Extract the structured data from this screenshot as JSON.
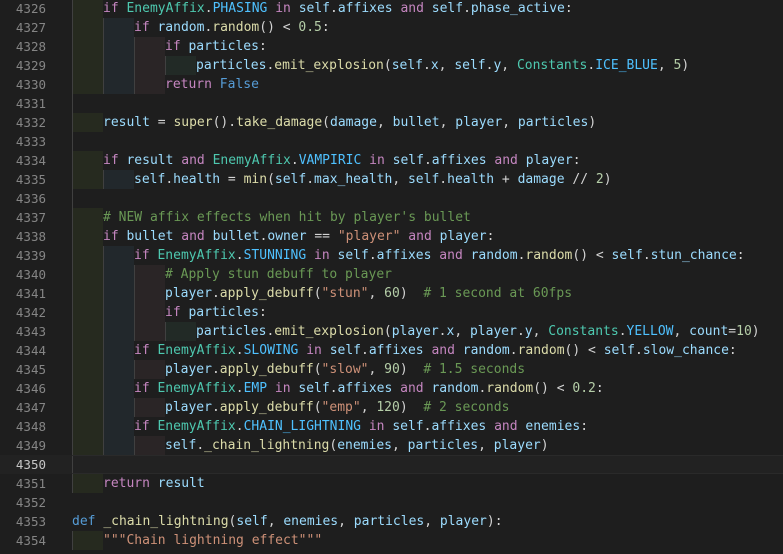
{
  "editor": {
    "current_line": 4350,
    "colors": {
      "background": "#1e1e1e",
      "keyword": "#c586c0",
      "class": "#4ec9b0",
      "constant": "#4fc1ff",
      "variable": "#9cdcfe",
      "function": "#dcdcaa",
      "string": "#ce9178",
      "number": "#b5cea8",
      "comment": "#6a9955"
    },
    "lines": [
      {
        "n": "4326",
        "indent": 1,
        "tokens": [
          [
            "kw",
            "if "
          ],
          [
            "cls",
            "EnemyAffix"
          ],
          [
            "op",
            "."
          ],
          [
            "const",
            "PHASING"
          ],
          [
            "kw",
            " in "
          ],
          [
            "var",
            "self"
          ],
          [
            "op",
            "."
          ],
          [
            "var",
            "affixes"
          ],
          [
            "kw",
            " and "
          ],
          [
            "var",
            "self"
          ],
          [
            "op",
            "."
          ],
          [
            "var",
            "phase_active"
          ],
          [
            "op",
            ":"
          ]
        ]
      },
      {
        "n": "4327",
        "indent": 2,
        "tokens": [
          [
            "kw",
            "if "
          ],
          [
            "var",
            "random"
          ],
          [
            "op",
            "."
          ],
          [
            "fn",
            "random"
          ],
          [
            "op",
            "() < "
          ],
          [
            "num",
            "0.5"
          ],
          [
            "op",
            ":"
          ]
        ]
      },
      {
        "n": "4328",
        "indent": 3,
        "tokens": [
          [
            "kw",
            "if "
          ],
          [
            "var",
            "particles"
          ],
          [
            "op",
            ":"
          ]
        ]
      },
      {
        "n": "4329",
        "indent": 4,
        "tokens": [
          [
            "var",
            "particles"
          ],
          [
            "op",
            "."
          ],
          [
            "fn",
            "emit_explosion"
          ],
          [
            "op",
            "("
          ],
          [
            "var",
            "self"
          ],
          [
            "op",
            "."
          ],
          [
            "var",
            "x"
          ],
          [
            "op",
            ", "
          ],
          [
            "var",
            "self"
          ],
          [
            "op",
            "."
          ],
          [
            "var",
            "y"
          ],
          [
            "op",
            ", "
          ],
          [
            "cls",
            "Constants"
          ],
          [
            "op",
            "."
          ],
          [
            "const",
            "ICE_BLUE"
          ],
          [
            "op",
            ", "
          ],
          [
            "num",
            "5"
          ],
          [
            "op",
            ")"
          ]
        ]
      },
      {
        "n": "4330",
        "indent": 3,
        "tokens": [
          [
            "kw",
            "return "
          ],
          [
            "bool",
            "False"
          ]
        ]
      },
      {
        "n": "4331",
        "indent": 0,
        "tokens": []
      },
      {
        "n": "4332",
        "indent": 1,
        "tokens": [
          [
            "var",
            "result"
          ],
          [
            "op",
            " = "
          ],
          [
            "fn",
            "super"
          ],
          [
            "op",
            "()."
          ],
          [
            "fn",
            "take_damage"
          ],
          [
            "op",
            "("
          ],
          [
            "var",
            "damage"
          ],
          [
            "op",
            ", "
          ],
          [
            "var",
            "bullet"
          ],
          [
            "op",
            ", "
          ],
          [
            "var",
            "player"
          ],
          [
            "op",
            ", "
          ],
          [
            "var",
            "particles"
          ],
          [
            "op",
            ")"
          ]
        ]
      },
      {
        "n": "4333",
        "indent": 0,
        "tokens": []
      },
      {
        "n": "4334",
        "indent": 1,
        "tokens": [
          [
            "kw",
            "if "
          ],
          [
            "var",
            "result"
          ],
          [
            "kw",
            " and "
          ],
          [
            "cls",
            "EnemyAffix"
          ],
          [
            "op",
            "."
          ],
          [
            "const",
            "VAMPIRIC"
          ],
          [
            "kw",
            " in "
          ],
          [
            "var",
            "self"
          ],
          [
            "op",
            "."
          ],
          [
            "var",
            "affixes"
          ],
          [
            "kw",
            " and "
          ],
          [
            "var",
            "player"
          ],
          [
            "op",
            ":"
          ]
        ]
      },
      {
        "n": "4335",
        "indent": 2,
        "tokens": [
          [
            "var",
            "self"
          ],
          [
            "op",
            "."
          ],
          [
            "var",
            "health"
          ],
          [
            "op",
            " = "
          ],
          [
            "fn",
            "min"
          ],
          [
            "op",
            "("
          ],
          [
            "var",
            "self"
          ],
          [
            "op",
            "."
          ],
          [
            "var",
            "max_health"
          ],
          [
            "op",
            ", "
          ],
          [
            "var",
            "self"
          ],
          [
            "op",
            "."
          ],
          [
            "var",
            "health"
          ],
          [
            "op",
            " + "
          ],
          [
            "var",
            "damage"
          ],
          [
            "op",
            " // "
          ],
          [
            "num",
            "2"
          ],
          [
            "op",
            ")"
          ]
        ]
      },
      {
        "n": "4336",
        "indent": 0,
        "tokens": []
      },
      {
        "n": "4337",
        "indent": 1,
        "tokens": [
          [
            "cmt",
            "# NEW affix effects when hit by player's bullet"
          ]
        ]
      },
      {
        "n": "4338",
        "indent": 1,
        "tokens": [
          [
            "kw",
            "if "
          ],
          [
            "var",
            "bullet"
          ],
          [
            "kw",
            " and "
          ],
          [
            "var",
            "bullet"
          ],
          [
            "op",
            "."
          ],
          [
            "var",
            "owner"
          ],
          [
            "op",
            " == "
          ],
          [
            "str",
            "\"player\""
          ],
          [
            "kw",
            " and "
          ],
          [
            "var",
            "player"
          ],
          [
            "op",
            ":"
          ]
        ]
      },
      {
        "n": "4339",
        "indent": 2,
        "tokens": [
          [
            "kw",
            "if "
          ],
          [
            "cls",
            "EnemyAffix"
          ],
          [
            "op",
            "."
          ],
          [
            "const",
            "STUNNING"
          ],
          [
            "kw",
            " in "
          ],
          [
            "var",
            "self"
          ],
          [
            "op",
            "."
          ],
          [
            "var",
            "affixes"
          ],
          [
            "kw",
            " and "
          ],
          [
            "var",
            "random"
          ],
          [
            "op",
            "."
          ],
          [
            "fn",
            "random"
          ],
          [
            "op",
            "() < "
          ],
          [
            "var",
            "self"
          ],
          [
            "op",
            "."
          ],
          [
            "var",
            "stun_chance"
          ],
          [
            "op",
            ":"
          ]
        ]
      },
      {
        "n": "4340",
        "indent": 3,
        "tokens": [
          [
            "cmt",
            "# Apply stun debuff to player"
          ]
        ]
      },
      {
        "n": "4341",
        "indent": 3,
        "tokens": [
          [
            "var",
            "player"
          ],
          [
            "op",
            "."
          ],
          [
            "fn",
            "apply_debuff"
          ],
          [
            "op",
            "("
          ],
          [
            "str",
            "\"stun\""
          ],
          [
            "op",
            ", "
          ],
          [
            "num",
            "60"
          ],
          [
            "op",
            ")  "
          ],
          [
            "cmt",
            "# 1 second at 60fps"
          ]
        ]
      },
      {
        "n": "4342",
        "indent": 3,
        "tokens": [
          [
            "kw",
            "if "
          ],
          [
            "var",
            "particles"
          ],
          [
            "op",
            ":"
          ]
        ]
      },
      {
        "n": "4343",
        "indent": 4,
        "tokens": [
          [
            "var",
            "particles"
          ],
          [
            "op",
            "."
          ],
          [
            "fn",
            "emit_explosion"
          ],
          [
            "op",
            "("
          ],
          [
            "var",
            "player"
          ],
          [
            "op",
            "."
          ],
          [
            "var",
            "x"
          ],
          [
            "op",
            ", "
          ],
          [
            "var",
            "player"
          ],
          [
            "op",
            "."
          ],
          [
            "var",
            "y"
          ],
          [
            "op",
            ", "
          ],
          [
            "cls",
            "Constants"
          ],
          [
            "op",
            "."
          ],
          [
            "const",
            "YELLOW"
          ],
          [
            "op",
            ", "
          ],
          [
            "var",
            "count"
          ],
          [
            "op",
            "="
          ],
          [
            "num",
            "10"
          ],
          [
            "op",
            ")"
          ]
        ]
      },
      {
        "n": "4344",
        "indent": 2,
        "tokens": [
          [
            "kw",
            "if "
          ],
          [
            "cls",
            "EnemyAffix"
          ],
          [
            "op",
            "."
          ],
          [
            "const",
            "SLOWING"
          ],
          [
            "kw",
            " in "
          ],
          [
            "var",
            "self"
          ],
          [
            "op",
            "."
          ],
          [
            "var",
            "affixes"
          ],
          [
            "kw",
            " and "
          ],
          [
            "var",
            "random"
          ],
          [
            "op",
            "."
          ],
          [
            "fn",
            "random"
          ],
          [
            "op",
            "() < "
          ],
          [
            "var",
            "self"
          ],
          [
            "op",
            "."
          ],
          [
            "var",
            "slow_chance"
          ],
          [
            "op",
            ":"
          ]
        ]
      },
      {
        "n": "4345",
        "indent": 3,
        "tokens": [
          [
            "var",
            "player"
          ],
          [
            "op",
            "."
          ],
          [
            "fn",
            "apply_debuff"
          ],
          [
            "op",
            "("
          ],
          [
            "str",
            "\"slow\""
          ],
          [
            "op",
            ", "
          ],
          [
            "num",
            "90"
          ],
          [
            "op",
            ")  "
          ],
          [
            "cmt",
            "# 1.5 seconds"
          ]
        ]
      },
      {
        "n": "4346",
        "indent": 2,
        "tokens": [
          [
            "kw",
            "if "
          ],
          [
            "cls",
            "EnemyAffix"
          ],
          [
            "op",
            "."
          ],
          [
            "const",
            "EMP"
          ],
          [
            "kw",
            " in "
          ],
          [
            "var",
            "self"
          ],
          [
            "op",
            "."
          ],
          [
            "var",
            "affixes"
          ],
          [
            "kw",
            " and "
          ],
          [
            "var",
            "random"
          ],
          [
            "op",
            "."
          ],
          [
            "fn",
            "random"
          ],
          [
            "op",
            "() < "
          ],
          [
            "num",
            "0.2"
          ],
          [
            "op",
            ":"
          ]
        ]
      },
      {
        "n": "4347",
        "indent": 3,
        "tokens": [
          [
            "var",
            "player"
          ],
          [
            "op",
            "."
          ],
          [
            "fn",
            "apply_debuff"
          ],
          [
            "op",
            "("
          ],
          [
            "str",
            "\"emp\""
          ],
          [
            "op",
            ", "
          ],
          [
            "num",
            "120"
          ],
          [
            "op",
            ")  "
          ],
          [
            "cmt",
            "# 2 seconds"
          ]
        ]
      },
      {
        "n": "4348",
        "indent": 2,
        "tokens": [
          [
            "kw",
            "if "
          ],
          [
            "cls",
            "EnemyAffix"
          ],
          [
            "op",
            "."
          ],
          [
            "const",
            "CHAIN_LIGHTNING"
          ],
          [
            "kw",
            " in "
          ],
          [
            "var",
            "self"
          ],
          [
            "op",
            "."
          ],
          [
            "var",
            "affixes"
          ],
          [
            "kw",
            " and "
          ],
          [
            "var",
            "enemies"
          ],
          [
            "op",
            ":"
          ]
        ]
      },
      {
        "n": "4349",
        "indent": 3,
        "tokens": [
          [
            "var",
            "self"
          ],
          [
            "op",
            "."
          ],
          [
            "fn",
            "_chain_lightning"
          ],
          [
            "op",
            "("
          ],
          [
            "var",
            "enemies"
          ],
          [
            "op",
            ", "
          ],
          [
            "var",
            "particles"
          ],
          [
            "op",
            ", "
          ],
          [
            "var",
            "player"
          ],
          [
            "op",
            ")"
          ]
        ]
      },
      {
        "n": "4350",
        "indent": 0,
        "tokens": []
      },
      {
        "n": "4351",
        "indent": 1,
        "tokens": [
          [
            "kw",
            "return "
          ],
          [
            "var",
            "result"
          ]
        ]
      },
      {
        "n": "4352",
        "indent": 0,
        "tokens": []
      },
      {
        "n": "4353",
        "indent": 0,
        "tokens": [
          [
            "def",
            "def "
          ],
          [
            "fn",
            "_chain_lightning"
          ],
          [
            "op",
            "("
          ],
          [
            "var",
            "self"
          ],
          [
            "op",
            ", "
          ],
          [
            "var",
            "enemies"
          ],
          [
            "op",
            ", "
          ],
          [
            "var",
            "particles"
          ],
          [
            "op",
            ", "
          ],
          [
            "var",
            "player"
          ],
          [
            "op",
            "):"
          ]
        ]
      },
      {
        "n": "4354",
        "indent": 1,
        "tokens": [
          [
            "str",
            "\"\"\"Chain lightning effect\"\"\""
          ]
        ]
      }
    ]
  }
}
